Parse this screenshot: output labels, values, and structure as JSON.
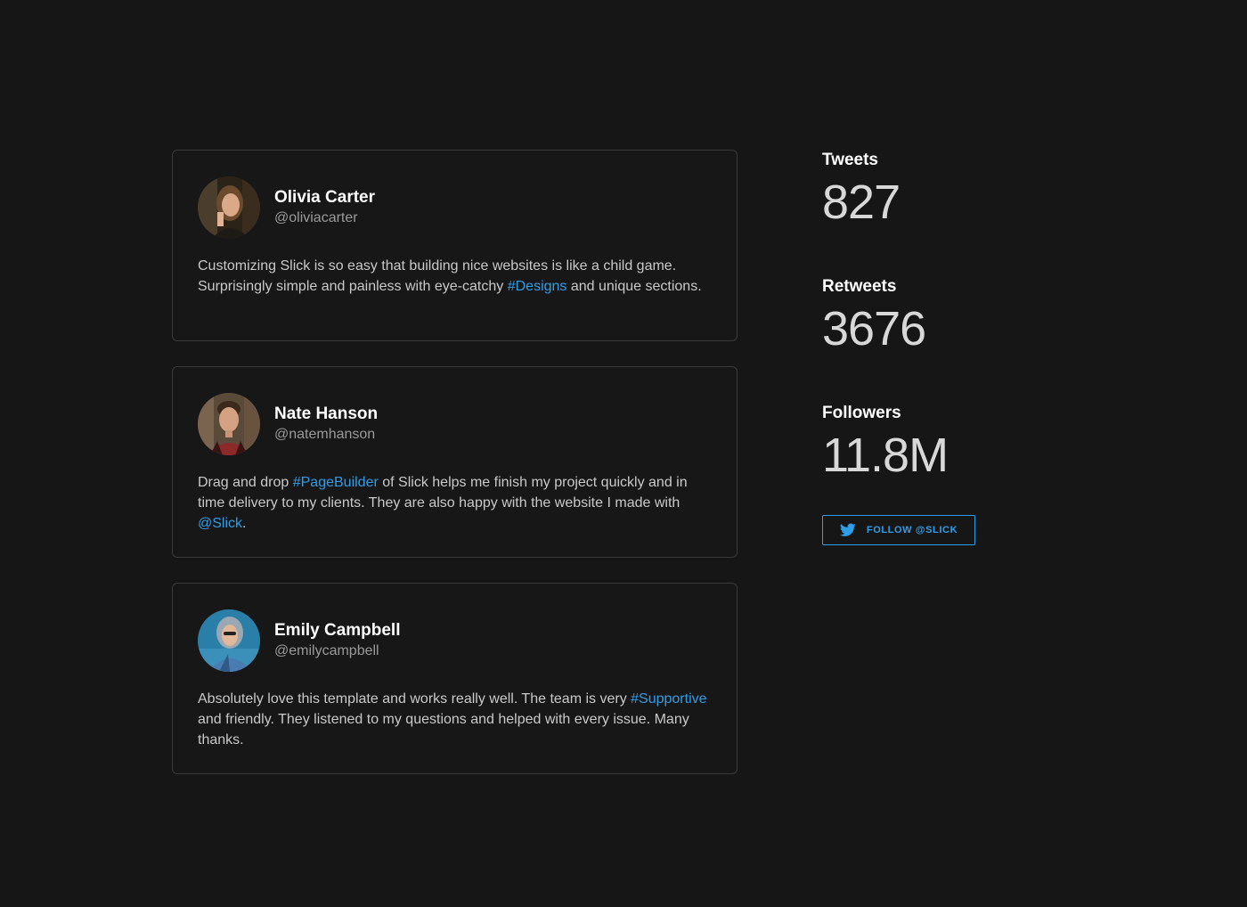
{
  "colors": {
    "background": "#161616",
    "card_border": "#3a3a3a",
    "accent": "#2f9ee8",
    "text": "#c9c9c9",
    "heading": "#ffffff",
    "muted": "#9a9a9a"
  },
  "tweets": [
    {
      "name": "Olivia Carter",
      "handle": "@oliviacarter",
      "avatar_icon": "avatar-photo",
      "text": {
        "before": "Customizing Slick is so easy that building nice websites is like a child game. Surprisingly simple and painless with eye-catchy ",
        "tag": "#Designs",
        "after": " and unique sections."
      }
    },
    {
      "name": "Nate Hanson",
      "handle": "@natemhanson",
      "avatar_icon": "avatar-photo",
      "text": {
        "before": "Drag and drop ",
        "tag": "#PageBuilder",
        "middle": " of Slick helps me finish my project quickly and in time delivery to my clients. They are also happy with the website I made with ",
        "mention": "@Slick",
        "after": "."
      }
    },
    {
      "name": "Emily Campbell",
      "handle": "@emilycampbell",
      "avatar_icon": "avatar-photo",
      "text": {
        "before": "Absolutely love this template and works really well. The team is very ",
        "tag": "#Supportive",
        "after": " and friendly. They listened to my questions and helped with every issue. Many thanks."
      }
    }
  ],
  "stats": {
    "tweets": {
      "label": "Tweets",
      "value": "827"
    },
    "retweets": {
      "label": "Retweets",
      "value": "3676"
    },
    "followers": {
      "label": "Followers",
      "value": "11.8M"
    }
  },
  "follow_button": {
    "label": "FOLLOW @SLICK",
    "icon": "twitter-bird-icon"
  }
}
